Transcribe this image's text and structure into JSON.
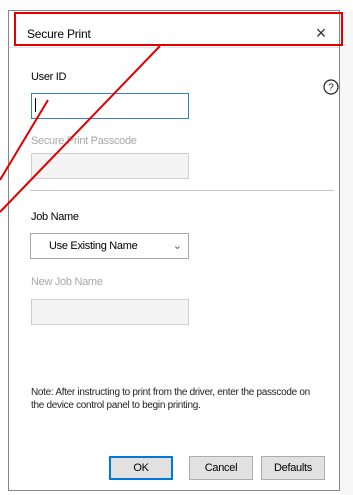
{
  "dialog": {
    "title": "Secure Print",
    "close_symbol": "×",
    "help_symbol": "?",
    "user_id": {
      "label": "User ID",
      "value": ""
    },
    "passcode": {
      "label": "Secure Print Passcode",
      "value": ""
    },
    "job_name": {
      "label": "Job Name",
      "selected": "Use Existing Name"
    },
    "new_job_name": {
      "label": "New Job Name",
      "value": ""
    },
    "note": "Note: After instructing to print from the driver, enter the passcode on the device control panel to begin printing.",
    "buttons": {
      "ok": "OK",
      "cancel": "Cancel",
      "defaults": "Defaults"
    }
  },
  "icons": [
    "close-icon",
    "help-icon",
    "chevron-down-icon"
  ],
  "colors": {
    "highlight": "#e00000",
    "focus": "#3a7bd5",
    "primary_border": "#0078d7"
  }
}
